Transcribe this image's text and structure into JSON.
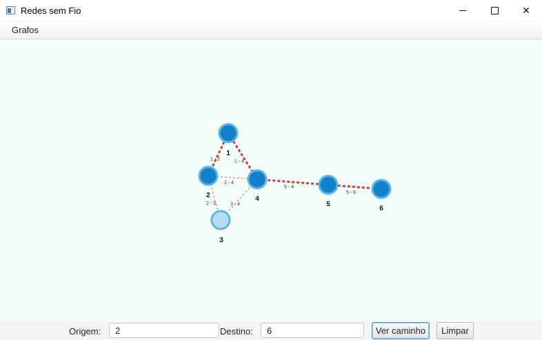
{
  "window": {
    "title": "Redes sem Fio"
  },
  "menu": {
    "items": [
      "Grafos"
    ]
  },
  "graph": {
    "nodes": [
      {
        "label": "1",
        "state": "normal"
      },
      {
        "label": "2",
        "state": "normal"
      },
      {
        "label": "3",
        "state": "selected"
      },
      {
        "label": "4",
        "state": "normal"
      },
      {
        "label": "5",
        "state": "normal"
      },
      {
        "label": "6",
        "state": "normal"
      }
    ],
    "edges": [
      {
        "label": "1 - 2",
        "style": "path"
      },
      {
        "label": "1 - 4",
        "style": "path"
      },
      {
        "label": "2 - 4",
        "style": "light"
      },
      {
        "label": "2 - 3",
        "style": "light"
      },
      {
        "label": "3 - 4",
        "style": "light"
      },
      {
        "label": "5 - 4",
        "style": "path"
      },
      {
        "label": "5 - 6",
        "style": "path"
      }
    ],
    "colors": {
      "node_fill": "#1282c8",
      "node_stroke": "#5cb4ee",
      "selected_fill": "#b4ddf7",
      "path_edge": "#d93a32",
      "light_edge": "#f0958a"
    }
  },
  "controls": {
    "origin_label": "Origem:",
    "origin_value": "2",
    "destination_label": "Destino:",
    "destination_value": "6",
    "path_button": "Ver caminho",
    "clear_button": "Limpar"
  }
}
